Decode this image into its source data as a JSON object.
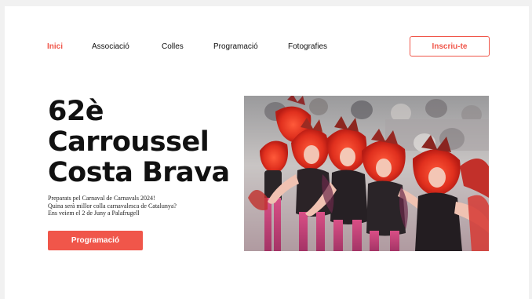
{
  "nav": {
    "items": [
      {
        "label": "Inici",
        "active": true
      },
      {
        "label": "Associació",
        "active": false
      },
      {
        "label": "Colles",
        "active": false
      },
      {
        "label": "Programació",
        "active": false
      },
      {
        "label": "Fotografies",
        "active": false
      }
    ],
    "cta_label": "Inscriu-te"
  },
  "hero": {
    "title_lines": [
      "62è",
      "Carroussel",
      "Costa Brava"
    ],
    "intro_lines": [
      "Preparats pel Carnaval de Carnavals 2024!",
      "Quina serà millor colla carnavalesca de Catalunya?",
      "Ens veiem el 2 de Juny a Palafrugell"
    ],
    "button_label": "Programació"
  },
  "colors": {
    "accent": "#f0564a",
    "text": "#111111",
    "background": "#ffffff"
  }
}
